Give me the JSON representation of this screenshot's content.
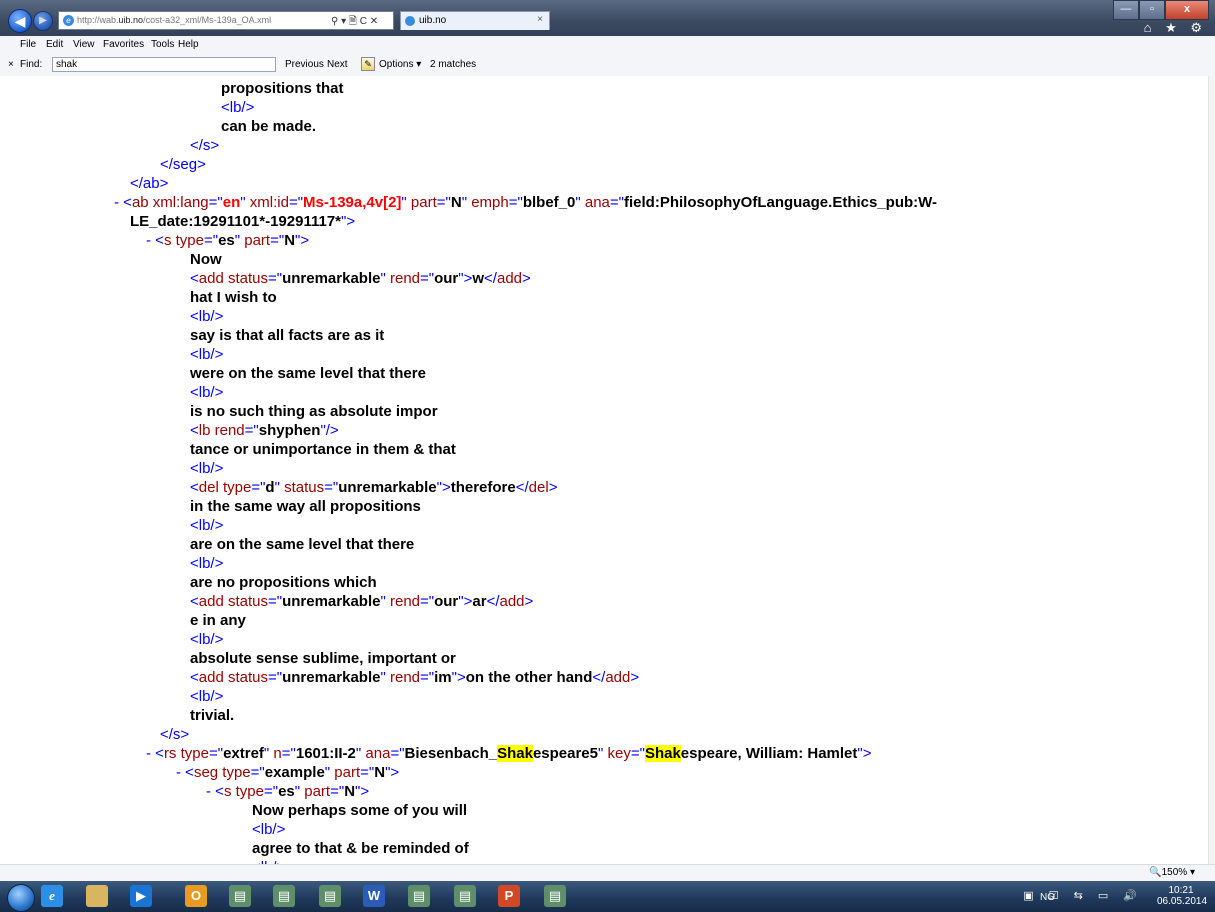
{
  "browser": {
    "url": "http://wab.uib.no/cost-a32_xml/Ms-139a_OA.xml",
    "url_prefix": "http://wab.",
    "url_domain": "uib.no",
    "url_suffix": "/cost-a32_xml/Ms-139a_OA.xml",
    "address_controls": "⚲ ▾ 🗎 C ✕",
    "tab_label": "uib.no",
    "tab_close": "×",
    "back": "◀",
    "forward": "▶",
    "window_min": "—",
    "window_max": "▫",
    "window_close": "x",
    "right_icons": "⌂ ★ ⚙"
  },
  "menu": [
    "File",
    "Edit",
    "View",
    "Favorites",
    "Tools",
    "Help"
  ],
  "find": {
    "close": "×",
    "label": "Find:",
    "value": "shak",
    "previous": "Previous",
    "next": "Next",
    "options": "Options ▾",
    "matches": "2 matches"
  },
  "status": {
    "zoom": "🔍150%  ▾"
  },
  "taskbar": {
    "lang": "NO",
    "time": "10:21",
    "date": "06.05.2014",
    "tray_icons": "▣ ☑ ⇆ ▭ 🔊",
    "apps": [
      "ie",
      "folder",
      "media-player",
      "outlook",
      "window",
      "window",
      "window",
      "word",
      "window",
      "window",
      "powerpoint",
      "window"
    ],
    "ie_glyph": "e",
    "word_glyph": "W",
    "ppt_glyph": "P",
    "outlook_glyph": "O"
  },
  "xml": {
    "lines": [
      {
        "i": 221,
        "k": "t",
        "text": "propositions that"
      },
      {
        "i": 221,
        "k": "m",
        "text": "<lb/>"
      },
      {
        "i": 221,
        "k": "t",
        "text": "can be made."
      },
      {
        "i": 190,
        "k": "m",
        "text": "</s>"
      },
      {
        "i": 160,
        "k": "m",
        "text": "</seg>"
      },
      {
        "i": 130,
        "k": "m",
        "text": "</ab>"
      },
      {
        "i": 114,
        "k": "ab1",
        "text": ""
      },
      {
        "i": 130,
        "k": "ab2",
        "text": ""
      },
      {
        "i": 146,
        "k": "s1",
        "text": ""
      },
      {
        "i": 190,
        "k": "t",
        "text": "Now"
      },
      {
        "i": 190,
        "k": "add1",
        "text": ""
      },
      {
        "i": 190,
        "k": "t",
        "text": "hat I wish to"
      },
      {
        "i": 190,
        "k": "m",
        "text": "<lb/>"
      },
      {
        "i": 190,
        "k": "t",
        "text": "say is that all facts are as it"
      },
      {
        "i": 190,
        "k": "m",
        "text": "<lb/>"
      },
      {
        "i": 190,
        "k": "t",
        "text": "were on the same level that there"
      },
      {
        "i": 190,
        "k": "m",
        "text": "<lb/>"
      },
      {
        "i": 190,
        "k": "t",
        "text": "is no such thing as absolute impor"
      },
      {
        "i": 190,
        "k": "lb2",
        "text": ""
      },
      {
        "i": 190,
        "k": "t",
        "text": "tance or unimportance in them & that"
      },
      {
        "i": 190,
        "k": "m",
        "text": "<lb/>"
      },
      {
        "i": 190,
        "k": "del1",
        "text": ""
      },
      {
        "i": 190,
        "k": "t",
        "text": "in the same way all propositions"
      },
      {
        "i": 190,
        "k": "m",
        "text": "<lb/>"
      },
      {
        "i": 190,
        "k": "t",
        "text": "are on the same level that there"
      },
      {
        "i": 190,
        "k": "m",
        "text": "<lb/>"
      },
      {
        "i": 190,
        "k": "t",
        "text": "are no propositions which"
      },
      {
        "i": 190,
        "k": "add2",
        "text": ""
      },
      {
        "i": 190,
        "k": "t",
        "text": "e in any"
      },
      {
        "i": 190,
        "k": "m",
        "text": "<lb/>"
      },
      {
        "i": 190,
        "k": "t",
        "text": "absolute sense sublime, important or"
      },
      {
        "i": 190,
        "k": "add3",
        "text": ""
      },
      {
        "i": 190,
        "k": "m",
        "text": "<lb/>"
      },
      {
        "i": 190,
        "k": "t",
        "text": "trivial."
      },
      {
        "i": 160,
        "k": "m",
        "text": "</s>"
      },
      {
        "i": 146,
        "k": "rs1",
        "text": ""
      },
      {
        "i": 176,
        "k": "seg1",
        "text": ""
      },
      {
        "i": 206,
        "k": "s2",
        "text": ""
      },
      {
        "i": 252,
        "k": "t",
        "text": "Now perhaps some of you will"
      },
      {
        "i": 252,
        "k": "m",
        "text": "<lb/>"
      },
      {
        "i": 252,
        "k": "t",
        "text": "agree to that & be reminded of"
      },
      {
        "i": 252,
        "k": "m",
        "text": "<lb/>"
      }
    ],
    "ab": {
      "dash": "- ",
      "lang_val": "en",
      "id_val": "Ms-139a,4v[2]",
      "part_val": "N",
      "emph_val": "blbef_0",
      "ana_val_1": "field:PhilosophyOfLanguage.Ethics_pub:W-",
      "ana_val_2": "LE_date:19291101*-19291117*"
    },
    "s1": {
      "type": "es",
      "part": "N"
    },
    "add1": {
      "status": "unremarkable",
      "rend": "our",
      "content": "w"
    },
    "lb2": {
      "rend": "shyphen"
    },
    "del1": {
      "type": "d",
      "status": "unremarkable",
      "content": "therefore"
    },
    "add2": {
      "status": "unremarkable",
      "rend": "our",
      "content": "ar"
    },
    "add3": {
      "status": "unremarkable",
      "rend": "im",
      "content": "on the other hand"
    },
    "rs1": {
      "type": "extref",
      "n": "1601:II-2",
      "ana_pre": "Biesenbach_",
      "ana_hl": "Shak",
      "ana_post": "espeare5",
      "key_hl": "Shak",
      "key_post": "espeare, William: Hamlet"
    },
    "seg1": {
      "type": "example",
      "part": "N"
    },
    "s2": {
      "type": "es",
      "part": "N"
    }
  }
}
